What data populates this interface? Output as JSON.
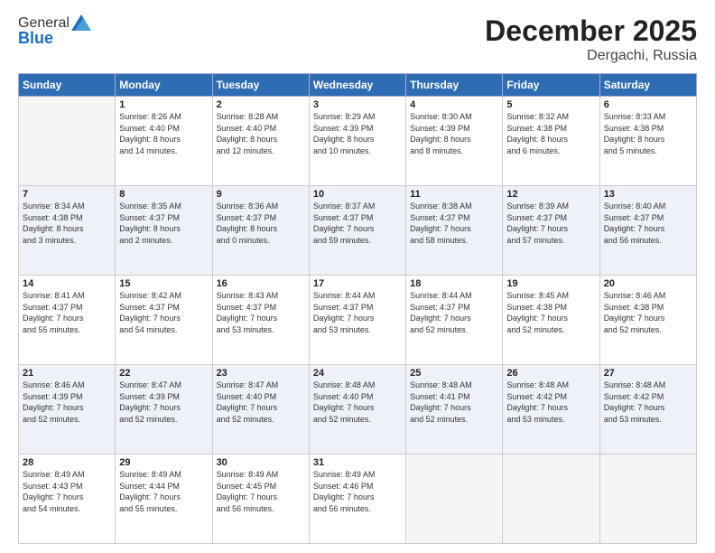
{
  "header": {
    "logo_line1": "General",
    "logo_line2": "Blue",
    "month": "December 2025",
    "location": "Dergachi, Russia"
  },
  "weekdays": [
    "Sunday",
    "Monday",
    "Tuesday",
    "Wednesday",
    "Thursday",
    "Friday",
    "Saturday"
  ],
  "weeks": [
    [
      {
        "day": "",
        "info": ""
      },
      {
        "day": "1",
        "info": "Sunrise: 8:26 AM\nSunset: 4:40 PM\nDaylight: 8 hours\nand 14 minutes."
      },
      {
        "day": "2",
        "info": "Sunrise: 8:28 AM\nSunset: 4:40 PM\nDaylight: 8 hours\nand 12 minutes."
      },
      {
        "day": "3",
        "info": "Sunrise: 8:29 AM\nSunset: 4:39 PM\nDaylight: 8 hours\nand 10 minutes."
      },
      {
        "day": "4",
        "info": "Sunrise: 8:30 AM\nSunset: 4:39 PM\nDaylight: 8 hours\nand 8 minutes."
      },
      {
        "day": "5",
        "info": "Sunrise: 8:32 AM\nSunset: 4:38 PM\nDaylight: 8 hours\nand 6 minutes."
      },
      {
        "day": "6",
        "info": "Sunrise: 8:33 AM\nSunset: 4:38 PM\nDaylight: 8 hours\nand 5 minutes."
      }
    ],
    [
      {
        "day": "7",
        "info": "Sunrise: 8:34 AM\nSunset: 4:38 PM\nDaylight: 8 hours\nand 3 minutes."
      },
      {
        "day": "8",
        "info": "Sunrise: 8:35 AM\nSunset: 4:37 PM\nDaylight: 8 hours\nand 2 minutes."
      },
      {
        "day": "9",
        "info": "Sunrise: 8:36 AM\nSunset: 4:37 PM\nDaylight: 8 hours\nand 0 minutes."
      },
      {
        "day": "10",
        "info": "Sunrise: 8:37 AM\nSunset: 4:37 PM\nDaylight: 7 hours\nand 59 minutes."
      },
      {
        "day": "11",
        "info": "Sunrise: 8:38 AM\nSunset: 4:37 PM\nDaylight: 7 hours\nand 58 minutes."
      },
      {
        "day": "12",
        "info": "Sunrise: 8:39 AM\nSunset: 4:37 PM\nDaylight: 7 hours\nand 57 minutes."
      },
      {
        "day": "13",
        "info": "Sunrise: 8:40 AM\nSunset: 4:37 PM\nDaylight: 7 hours\nand 56 minutes."
      }
    ],
    [
      {
        "day": "14",
        "info": "Sunrise: 8:41 AM\nSunset: 4:37 PM\nDaylight: 7 hours\nand 55 minutes."
      },
      {
        "day": "15",
        "info": "Sunrise: 8:42 AM\nSunset: 4:37 PM\nDaylight: 7 hours\nand 54 minutes."
      },
      {
        "day": "16",
        "info": "Sunrise: 8:43 AM\nSunset: 4:37 PM\nDaylight: 7 hours\nand 53 minutes."
      },
      {
        "day": "17",
        "info": "Sunrise: 8:44 AM\nSunset: 4:37 PM\nDaylight: 7 hours\nand 53 minutes."
      },
      {
        "day": "18",
        "info": "Sunrise: 8:44 AM\nSunset: 4:37 PM\nDaylight: 7 hours\nand 52 minutes."
      },
      {
        "day": "19",
        "info": "Sunrise: 8:45 AM\nSunset: 4:38 PM\nDaylight: 7 hours\nand 52 minutes."
      },
      {
        "day": "20",
        "info": "Sunrise: 8:46 AM\nSunset: 4:38 PM\nDaylight: 7 hours\nand 52 minutes."
      }
    ],
    [
      {
        "day": "21",
        "info": "Sunrise: 8:46 AM\nSunset: 4:39 PM\nDaylight: 7 hours\nand 52 minutes."
      },
      {
        "day": "22",
        "info": "Sunrise: 8:47 AM\nSunset: 4:39 PM\nDaylight: 7 hours\nand 52 minutes."
      },
      {
        "day": "23",
        "info": "Sunrise: 8:47 AM\nSunset: 4:40 PM\nDaylight: 7 hours\nand 52 minutes."
      },
      {
        "day": "24",
        "info": "Sunrise: 8:48 AM\nSunset: 4:40 PM\nDaylight: 7 hours\nand 52 minutes."
      },
      {
        "day": "25",
        "info": "Sunrise: 8:48 AM\nSunset: 4:41 PM\nDaylight: 7 hours\nand 52 minutes."
      },
      {
        "day": "26",
        "info": "Sunrise: 8:48 AM\nSunset: 4:42 PM\nDaylight: 7 hours\nand 53 minutes."
      },
      {
        "day": "27",
        "info": "Sunrise: 8:48 AM\nSunset: 4:42 PM\nDaylight: 7 hours\nand 53 minutes."
      }
    ],
    [
      {
        "day": "28",
        "info": "Sunrise: 8:49 AM\nSunset: 4:43 PM\nDaylight: 7 hours\nand 54 minutes."
      },
      {
        "day": "29",
        "info": "Sunrise: 8:49 AM\nSunset: 4:44 PM\nDaylight: 7 hours\nand 55 minutes."
      },
      {
        "day": "30",
        "info": "Sunrise: 8:49 AM\nSunset: 4:45 PM\nDaylight: 7 hours\nand 56 minutes."
      },
      {
        "day": "31",
        "info": "Sunrise: 8:49 AM\nSunset: 4:46 PM\nDaylight: 7 hours\nand 56 minutes."
      },
      {
        "day": "",
        "info": ""
      },
      {
        "day": "",
        "info": ""
      },
      {
        "day": "",
        "info": ""
      }
    ]
  ]
}
